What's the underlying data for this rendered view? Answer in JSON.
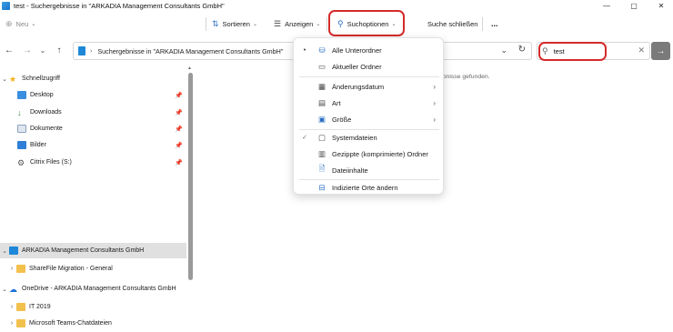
{
  "window": {
    "title": "test - Suchergebnisse in \"ARKADIA Management Consultants GmbH\"",
    "controls": [
      "—",
      "▢",
      "✕"
    ]
  },
  "toolbar": {
    "new_label": "Neu",
    "sort_label": "Sortieren",
    "view_label": "Anzeigen",
    "search_options_label": "Suchoptionen",
    "close_search_label": "Suche schließen",
    "more_label": "..."
  },
  "address": {
    "path": "Suchergebnisse in \"ARKADIA Management Consultants GmbH\""
  },
  "search": {
    "value": "test"
  },
  "sidebar": {
    "quick_access": "Schnellzugriff",
    "items": [
      {
        "label": "Desktop"
      },
      {
        "label": "Downloads"
      },
      {
        "label": "Dokumente"
      },
      {
        "label": "Bilder"
      },
      {
        "label": "Citrix Files (S:)"
      }
    ],
    "company": "ARKADIA Management Consultants GmbH",
    "sharefile": "ShareFile Migration - General",
    "onedrive": "OneDrive - ARKADIA Management Consultants GmbH",
    "it": "IT 2019",
    "teams": "Microsoft Teams-Chatdateien"
  },
  "content": {
    "message": "ebnisse gefunden."
  },
  "menu": {
    "items": [
      {
        "label": "Alle Unterordner"
      },
      {
        "label": "Aktueller Ordner"
      },
      {
        "label": "Änderungsdatum"
      },
      {
        "label": "Art"
      },
      {
        "label": "Größe"
      },
      {
        "label": "Systemdateien"
      },
      {
        "label": "Gezippte (komprimierte) Ordner"
      },
      {
        "label": "Dateiinhalte"
      },
      {
        "label": "Indizierte Orte ändern"
      }
    ]
  },
  "colors": {
    "highlight": "#d42a2a",
    "accent": "#2b6fc2",
    "folder": "#f2c04c"
  }
}
